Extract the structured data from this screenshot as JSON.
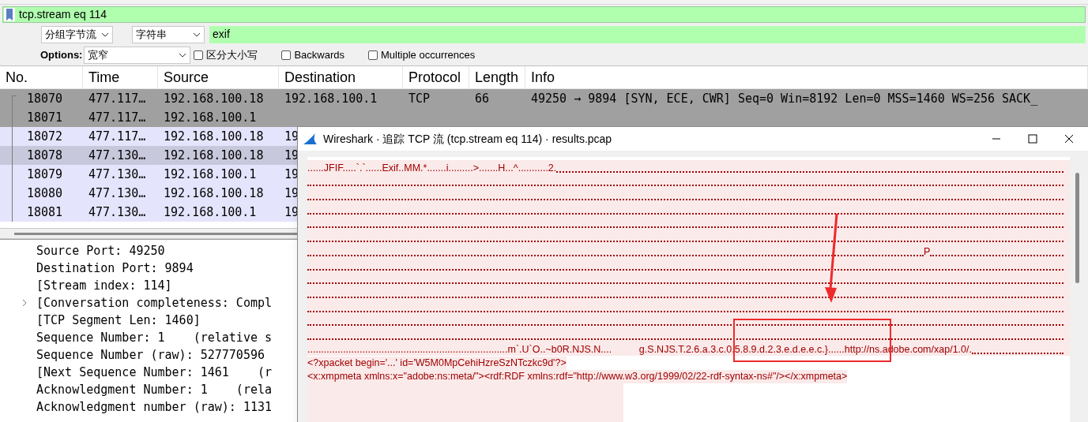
{
  "display_filter": {
    "value": "tcp.stream eq 114"
  },
  "find_bar": {
    "search_in": "分组字节流",
    "search_type": "字符串",
    "query": "exif",
    "options_label": "Options:",
    "charset": "宽窄",
    "checkboxes": [
      {
        "label": "区分大小写",
        "checked": false
      },
      {
        "label": "Backwards",
        "checked": false
      },
      {
        "label": "Multiple occurrences",
        "checked": false
      }
    ]
  },
  "packet_list": {
    "columns": [
      "No.",
      "Time",
      "Source",
      "Destination",
      "Protocol",
      "Length",
      "Info"
    ],
    "rows": [
      {
        "cells": [
          "18070",
          "477.117…",
          "192.168.100.18",
          "192.168.100.1",
          "TCP",
          "66",
          "49250 → 9894 [SYN, ECE, CWR] Seq=0 Win=8192 Len=0 MSS=1460 WS=256 SACK_"
        ],
        "color": "#a0a0a0"
      },
      {
        "cells": [
          "18071",
          "477.117…",
          "192.168.100.1"
        ],
        "color": "#a0a0a0"
      },
      {
        "cells": [
          "18072",
          "477.117…",
          "192.168.100.18",
          "19"
        ],
        "color": "#e4e4fc"
      },
      {
        "cells": [
          "18078",
          "477.130…",
          "192.168.100.18",
          "19"
        ],
        "color": "#c8c8dc"
      },
      {
        "cells": [
          "18079",
          "477.130…",
          "192.168.100.1",
          "19"
        ],
        "color": "#e4e4fc"
      },
      {
        "cells": [
          "18080",
          "477.130…",
          "192.168.100.18",
          "19"
        ],
        "color": "#e4e4fc"
      },
      {
        "cells": [
          "18081",
          "477.130…",
          "192.168.100.1",
          "19"
        ],
        "color": "#e4e4fc"
      }
    ]
  },
  "details": [
    {
      "text": "Source Port: 49250",
      "expandable": false
    },
    {
      "text": "Destination Port: 9894",
      "expandable": false
    },
    {
      "text": "[Stream index: 114]",
      "expandable": false
    },
    {
      "text": "[Conversation completeness: Compl",
      "expandable": true
    },
    {
      "text": "[TCP Segment Len: 1460]",
      "expandable": false
    },
    {
      "text": "Sequence Number: 1    (relative s",
      "expandable": false
    },
    {
      "text": "Sequence Number (raw): 527770596",
      "expandable": false
    },
    {
      "text": "[Next Sequence Number: 1461    (r",
      "expandable": false
    },
    {
      "text": "Acknowledgment Number: 1    (rela",
      "expandable": false
    },
    {
      "text": "Acknowledgment number (raw): 1131",
      "expandable": false
    }
  ],
  "dialog": {
    "title": "Wireshark · 追踪 TCP 流 (tcp.stream eq 114) · results.pcap",
    "stream_lines": [
      {
        "kind": "text",
        "text": "......JFIF.....`.`......Exif..MM.*.......i.........>.......H...^...........2."
      },
      {
        "kind": "dots"
      },
      {
        "kind": "dots"
      },
      {
        "kind": "dots"
      },
      {
        "kind": "dots"
      },
      {
        "kind": "dots"
      },
      {
        "kind": "far",
        "text": "P"
      },
      {
        "kind": "dots"
      },
      {
        "kind": "dots"
      },
      {
        "kind": "dots"
      },
      {
        "kind": "dots"
      },
      {
        "kind": "dots"
      },
      {
        "kind": "dots"
      },
      {
        "kind": "text",
        "text": ".........................................................................m`.U`O..~b0R.NJS.N....          g.S.NJS.T.2.6.a.3.c.0.5.8.9.d.2.3.e.d.e.e.c.}......http://ns.adobe.com/xap/1.0/."
      },
      {
        "kind": "xml",
        "text": "<?xpacket begin='...' id='W5M0MpCehiHzreSzNTczkc9d'?>"
      },
      {
        "kind": "xml",
        "text": "<x:xmpmeta xmlns:x=\"adobe:ns:meta/\"><rdf:RDF xmlns:rdf=\"http://www.w3.org/1999/02/22-rdf-syntax-ns#\"/></x:xmpmeta>"
      }
    ]
  }
}
